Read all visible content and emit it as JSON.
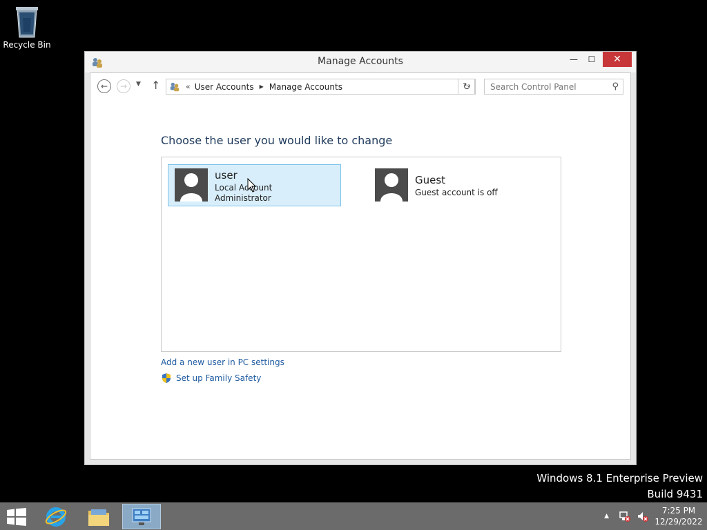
{
  "desktop": {
    "recycle_bin_label": "Recycle Bin",
    "watermark_line1": "Windows 8.1 Enterprise Preview",
    "watermark_line2": "Build 9431"
  },
  "window": {
    "title": "Manage Accounts",
    "buttons": {
      "minimize": "—",
      "maximize": "☐",
      "close": "✕"
    }
  },
  "address": {
    "overflow": "«",
    "crumbs": [
      "User Accounts",
      "Manage Accounts"
    ],
    "search_placeholder": "Search Control Panel"
  },
  "main": {
    "heading": "Choose the user you would like to change",
    "accounts": [
      {
        "name": "user",
        "line1": "Local Account",
        "line2": "Administrator",
        "selected": true
      },
      {
        "name": "Guest",
        "line1": "Guest account is off",
        "selected": false
      }
    ],
    "links": {
      "add_user": "Add a new user in PC settings",
      "family_safety": "Set up Family Safety"
    }
  },
  "taskbar": {
    "clock_time": "7:25 PM",
    "clock_date": "12/29/2022"
  },
  "colors": {
    "accent_link": "#1e5aa0",
    "heading": "#1e395b",
    "selection_bg": "#d8eefb",
    "close_button": "#c7373a"
  }
}
